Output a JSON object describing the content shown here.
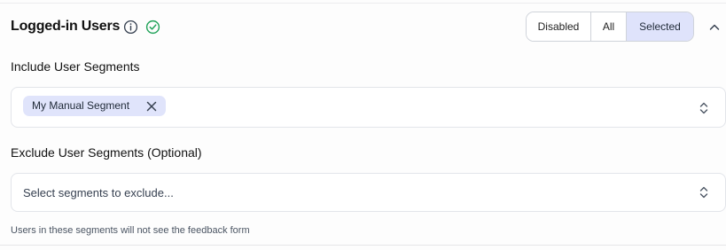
{
  "header": {
    "title": "Logged-in Users",
    "info_icon": "info-icon",
    "status_icon": "check-circle-icon",
    "status_color": "#22a35a",
    "collapse_icon": "chevron-up-icon"
  },
  "visibility_toggle": {
    "options": [
      "Disabled",
      "All",
      "Selected"
    ],
    "selected": "Selected",
    "selected_color": "#dfe3fb"
  },
  "include": {
    "label": "Include User Segments",
    "chips": [
      {
        "label": "My Manual Segment",
        "remove_icon": "close-icon"
      }
    ],
    "chevron_icon": "chevron-up-down-icon"
  },
  "exclude": {
    "label": "Exclude User Segments (Optional)",
    "placeholder": "Select segments to exclude...",
    "chevron_icon": "chevron-up-down-icon",
    "hint": "Users in these segments will not see the feedback form"
  }
}
